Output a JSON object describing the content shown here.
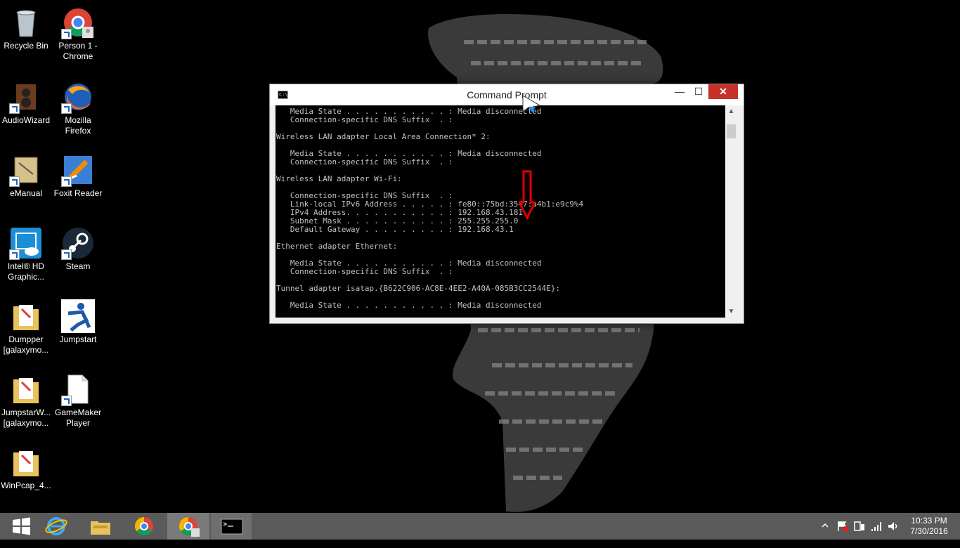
{
  "desktop": {
    "icons": [
      {
        "label": "Recycle Bin"
      },
      {
        "label": "Person 1 - Chrome"
      },
      {
        "label": "AudioWizard"
      },
      {
        "label": "Mozilla Firefox"
      },
      {
        "label": "eManual"
      },
      {
        "label": "Foxit Reader"
      },
      {
        "label": "Intel® HD Graphic..."
      },
      {
        "label": "Steam"
      },
      {
        "label": "Dumpper [galaxymo..."
      },
      {
        "label": "Jumpstart"
      },
      {
        "label": "JumpstarW... [galaxymo..."
      },
      {
        "label": "GameMaker Player"
      },
      {
        "label": "WinPcap_4..."
      }
    ]
  },
  "cmd": {
    "title": "Command Prompt",
    "icon_label": "C:\\",
    "minimize": "—",
    "maximize": "☐",
    "close": "✕",
    "lines": [
      "   Media State . . . . . . . . . . . : Media disconnected",
      "   Connection-specific DNS Suffix  . :",
      "",
      "Wireless LAN adapter Local Area Connection* 2:",
      "",
      "   Media State . . . . . . . . . . . : Media disconnected",
      "   Connection-specific DNS Suffix  . :",
      "",
      "Wireless LAN adapter Wi-Fi:",
      "",
      "   Connection-specific DNS Suffix  . :",
      "   Link-local IPv6 Address . . . . . : fe80::75bd:3547:a4b1:e9c9%4",
      "   IPv4 Address. . . . . . . . . . . : 192.168.43.181",
      "   Subnet Mask . . . . . . . . . . . : 255.255.255.0",
      "   Default Gateway . . . . . . . . . : 192.168.43.1",
      "",
      "Ethernet adapter Ethernet:",
      "",
      "   Media State . . . . . . . . . . . : Media disconnected",
      "   Connection-specific DNS Suffix  . :",
      "",
      "Tunnel adapter isatap.{B622C906-AC8E-4EE2-A40A-085B3CC2544E}:",
      "",
      "   Media State . . . . . . . . . . . : Media disconnected"
    ]
  },
  "colors": {
    "console_bg": "#000000",
    "console_text": "#c0c0c0",
    "close_button": "#c7302b",
    "annotation_arrow": "#e00000",
    "taskbar": "#5a5a5a"
  },
  "taskbar": {
    "items": [
      {
        "icon": "windows-start-icon"
      },
      {
        "icon": "internet-explorer-icon"
      },
      {
        "icon": "file-explorer-icon"
      },
      {
        "icon": "chrome-icon"
      },
      {
        "icon": "chrome-person-icon"
      },
      {
        "icon": "command-prompt-icon"
      }
    ],
    "clock": {
      "time": "10:33 PM",
      "date": "7/30/2016"
    }
  }
}
